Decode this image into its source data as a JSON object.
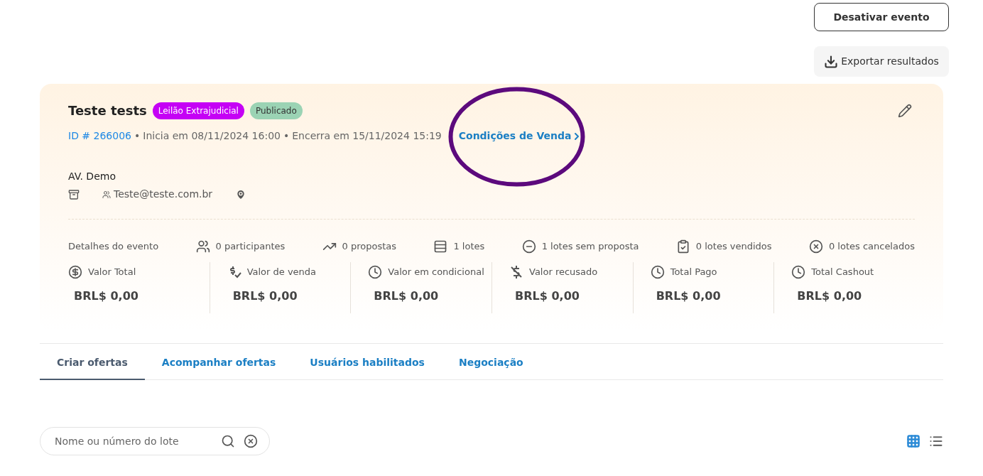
{
  "actions": {
    "deactivate": "Desativar evento",
    "export": "Exportar resultados"
  },
  "event": {
    "title": "Teste tests",
    "badges": [
      {
        "label": "Leilão Extrajudicial",
        "color": "#c501f5"
      },
      {
        "label": "Publicado",
        "color": "#9bd3b4"
      }
    ],
    "id": "ID # 266006",
    "separator": "•",
    "starts": "Inicia em 08/11/2024 16:00",
    "ends": "Encerra em 15/11/2024 15:19",
    "conditions_link": "Condições de Venda",
    "organizer": "AV. Demo",
    "email": "Teste@teste.com.br"
  },
  "details_label": "Detalhes do evento",
  "stats": [
    {
      "kind": "participants",
      "text": "0 participantes"
    },
    {
      "kind": "proposals",
      "text": "0 propostas"
    },
    {
      "kind": "lots",
      "text": "1 lotes"
    },
    {
      "kind": "no_proposal",
      "text": "1 lotes sem proposta"
    },
    {
      "kind": "sold",
      "text": "0 lotes vendidos"
    },
    {
      "kind": "cancelled",
      "text": "0 lotes cancelados"
    }
  ],
  "values": [
    {
      "kind": "dollar",
      "label": "Valor Total",
      "amount": "BRL$ 0,00"
    },
    {
      "kind": "sale",
      "label": "Valor de venda",
      "amount": "BRL$ 0,00"
    },
    {
      "kind": "clock",
      "label": "Valor em condicional",
      "amount": "BRL$ 0,00"
    },
    {
      "kind": "refused",
      "label": "Valor recusado",
      "amount": "BRL$ 0,00"
    },
    {
      "kind": "clock",
      "label": "Total Pago",
      "amount": "BRL$ 0,00"
    },
    {
      "kind": "clock",
      "label": "Total Cashout",
      "amount": "BRL$ 0,00"
    }
  ],
  "tabs": [
    {
      "label": "Criar ofertas",
      "selected": true
    },
    {
      "label": "Acompanhar ofertas",
      "selected": false
    },
    {
      "label": "Usuários habilitados",
      "selected": false
    },
    {
      "label": "Negociação",
      "selected": false
    }
  ],
  "search": {
    "placeholder": "Nome ou número do lote"
  },
  "views": [
    {
      "kind": "grid",
      "selected": true
    },
    {
      "kind": "list",
      "selected": false
    }
  ]
}
